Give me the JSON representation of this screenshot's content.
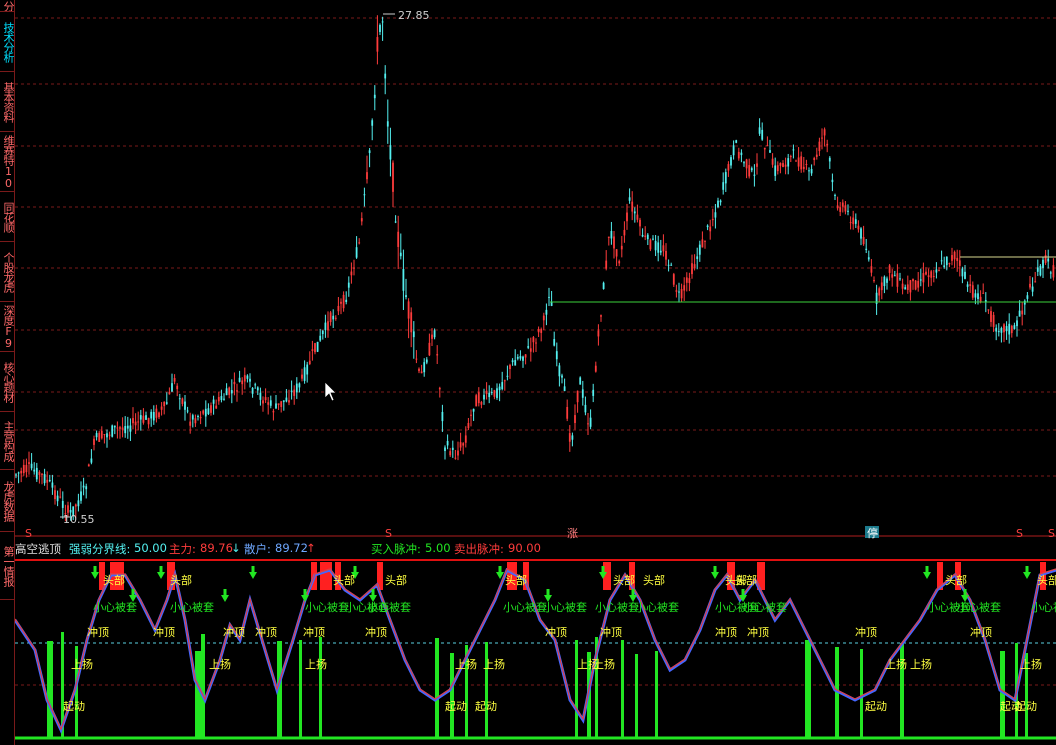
{
  "sidebar": {
    "tabs": [
      {
        "label": "分",
        "active": false
      },
      {
        "label": "技术分析",
        "active": true
      },
      {
        "label": "基本资料",
        "active": false
      },
      {
        "label": "维赛特10",
        "active": false
      },
      {
        "label": "同花顺",
        "active": false
      },
      {
        "label": "个股龙虎",
        "active": false
      },
      {
        "label": "深度F9",
        "active": false
      },
      {
        "label": "核心题材",
        "active": false
      },
      {
        "label": "主营构成",
        "active": false
      },
      {
        "label": "龙虎数据",
        "active": false
      },
      {
        "label": "第一情报",
        "active": false
      }
    ]
  },
  "price_chart": {
    "high_label": "27.85",
    "low_label": "10.55",
    "markers": [
      "S",
      "S",
      "涨",
      "停",
      "S",
      "S"
    ]
  },
  "indicator": {
    "name": "高空逃顶",
    "threshold_label": "强弱分界线:",
    "threshold_value": "50.00",
    "main_label": "主力:",
    "main_value": "89.76",
    "main_arrow": "↓",
    "retail_label": "散户:",
    "retail_value": "89.72",
    "retail_arrow": "↑",
    "buy_label": "买入脉冲:",
    "buy_value": "5.00",
    "sell_label": "卖出脉冲:",
    "sell_value": "90.00",
    "text_labels": {
      "top": "头部",
      "caution": "小心被套",
      "rush": "冲顶",
      "rise": "上扬",
      "start": "起动"
    }
  },
  "colors": {
    "up": "#ff3c3c",
    "down": "#54f0f0",
    "grid": "#7a1a1a",
    "green": "#22e622",
    "yellow": "#ffff40",
    "blue": "#4466ff"
  },
  "chart_data": {
    "type": "candlestick",
    "price_high": 27.85,
    "price_low": 10.55,
    "indicator_threshold": 50,
    "indicator_main": 89.76,
    "indicator_retail": 89.72,
    "buy_pulse": 5,
    "sell_pulse": 90
  }
}
